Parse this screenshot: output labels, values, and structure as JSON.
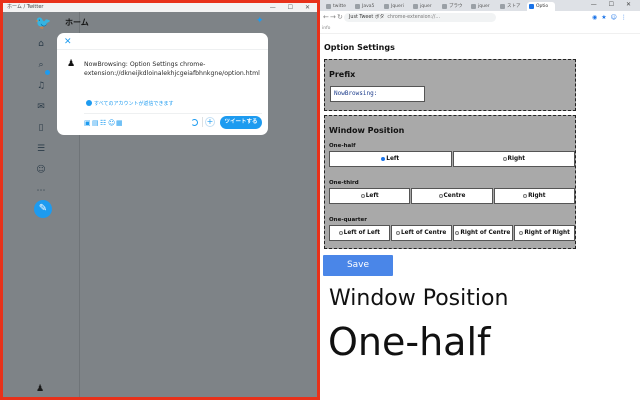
{
  "twitter": {
    "window_title": "ホーム / Twitter",
    "home_title": "ホーム",
    "compose": {
      "tweet_text": "NowBrowsing: Option Settings chrome-extension://dkneijkdloinalekhjcgeiafbhnkgne/option.html",
      "reply_setting": "すべてのアカウントが返信できます",
      "tweet_button": "ツイートする"
    },
    "sidebar_icons": [
      "twitter-logo-icon",
      "home-icon",
      "explore-icon",
      "notifications-icon",
      "messages-icon",
      "bookmarks-icon",
      "lists-icon",
      "profile-icon",
      "more-icon",
      "compose-icon"
    ]
  },
  "chrome": {
    "tabs": [
      {
        "label": "twitte"
      },
      {
        "label": "Java5"
      },
      {
        "label": "Jqueri"
      },
      {
        "label": "jquer"
      },
      {
        "label": "ブラウ"
      },
      {
        "label": "jquer"
      },
      {
        "label": "ストア"
      },
      {
        "label": "Optio"
      }
    ],
    "omnibox_title": "Just Tweet ボタ",
    "omnibox_url": "chrome-extension://...",
    "infobar_text": "info"
  },
  "options": {
    "page_title": "Option Settings",
    "prefix": {
      "heading": "Prefix",
      "value": "NowBrowsing:"
    },
    "window_position": {
      "heading": "Window Position",
      "one_half": {
        "label": "One-half",
        "options": [
          "Left",
          "Right"
        ],
        "selected": "Left"
      },
      "one_third": {
        "label": "One-third",
        "options": [
          "Left",
          "Centre",
          "Right"
        ],
        "selected": ""
      },
      "one_quarter": {
        "label": "One-quarter",
        "options": [
          "Left of Left",
          "Left of Centre",
          "Right of Centre",
          "Right of Right"
        ],
        "selected": ""
      }
    },
    "save_label": "Save",
    "overlay_line1": "Window Position",
    "overlay_line2": "One-half"
  },
  "colors": {
    "twitter_blue": "#1d9bf0",
    "frame_red": "#e8311a",
    "panel_gray": "#a9a9a9",
    "save_blue": "#4a86e8"
  }
}
